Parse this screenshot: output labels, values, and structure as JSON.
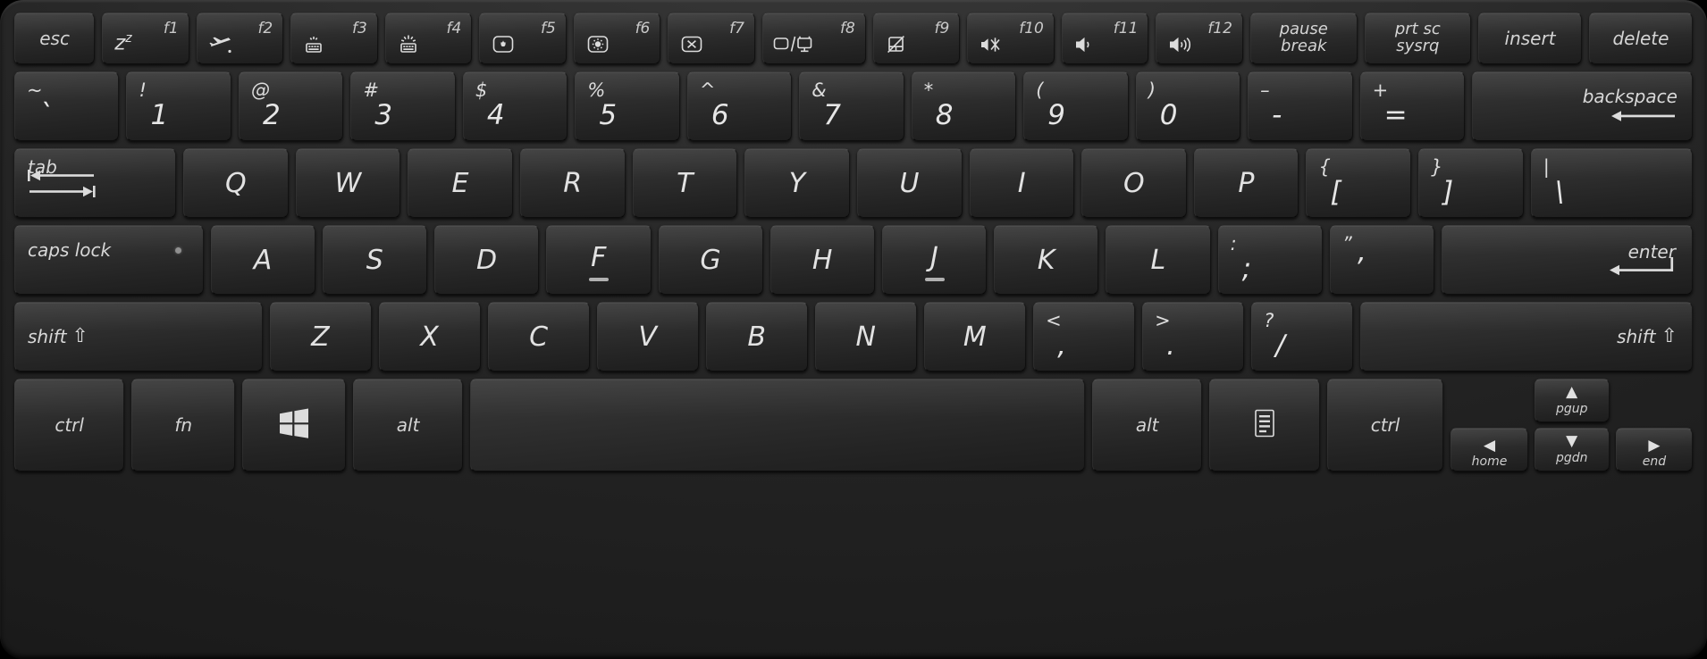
{
  "device": {
    "name": "ASUS laptop chiclet keyboard",
    "layout": "US ANSI",
    "body_color": "#262626",
    "key_color": "#2e2e2e",
    "legend_color": "#e2e2e2"
  },
  "rows": {
    "function_row": [
      {
        "id": "esc",
        "label": "esc",
        "type": "word",
        "fn": "",
        "icon": ""
      },
      {
        "id": "f1",
        "label": "",
        "type": "fn",
        "fn": "f1",
        "icon": "sleep-zz"
      },
      {
        "id": "f2",
        "label": "",
        "type": "fn",
        "fn": "f2",
        "icon": "airplane-mode"
      },
      {
        "id": "f3",
        "label": "",
        "type": "fn",
        "fn": "f3",
        "icon": "keyboard-backlight-down"
      },
      {
        "id": "f4",
        "label": "",
        "type": "fn",
        "fn": "f4",
        "icon": "keyboard-backlight-up"
      },
      {
        "id": "f5",
        "label": "",
        "type": "fn",
        "fn": "f5",
        "icon": "brightness-down"
      },
      {
        "id": "f6",
        "label": "",
        "type": "fn",
        "fn": "f6",
        "icon": "brightness-up"
      },
      {
        "id": "f7",
        "label": "",
        "type": "fn",
        "fn": "f7",
        "icon": "display-off"
      },
      {
        "id": "f8",
        "label": "",
        "type": "fn",
        "fn": "f8",
        "icon": "switch-display"
      },
      {
        "id": "f9",
        "label": "",
        "type": "fn",
        "fn": "f9",
        "icon": "touchpad-toggle"
      },
      {
        "id": "f10",
        "label": "",
        "type": "fn",
        "fn": "f10",
        "icon": "volume-mute"
      },
      {
        "id": "f11",
        "label": "",
        "type": "fn",
        "fn": "f11",
        "icon": "volume-down"
      },
      {
        "id": "f12",
        "label": "",
        "type": "fn",
        "fn": "f12",
        "icon": "volume-up"
      },
      {
        "id": "pause",
        "label": "pause\nbreak",
        "type": "word2",
        "line1": "pause",
        "line2": "break"
      },
      {
        "id": "prtsc",
        "label": "prt sc\nsysrq",
        "type": "word2",
        "line1": "prt sc",
        "line2": "sysrq"
      },
      {
        "id": "insert",
        "label": "insert",
        "type": "word"
      },
      {
        "id": "delete",
        "label": "delete",
        "type": "word"
      }
    ],
    "number_row": [
      {
        "id": "backtick",
        "shift": "~",
        "base": "`"
      },
      {
        "id": "1",
        "shift": "!",
        "base": "1"
      },
      {
        "id": "2",
        "shift": "@",
        "base": "2"
      },
      {
        "id": "3",
        "shift": "#",
        "base": "3"
      },
      {
        "id": "4",
        "shift": "$",
        "base": "4"
      },
      {
        "id": "5",
        "shift": "%",
        "base": "5"
      },
      {
        "id": "6",
        "shift": "^",
        "base": "6"
      },
      {
        "id": "7",
        "shift": "&",
        "base": "7"
      },
      {
        "id": "8",
        "shift": "*",
        "base": "8"
      },
      {
        "id": "9",
        "shift": "(",
        "base": "9"
      },
      {
        "id": "0",
        "shift": ")",
        "base": "0"
      },
      {
        "id": "minus",
        "shift": "–",
        "base": "-"
      },
      {
        "id": "equals",
        "shift": "+",
        "base": "="
      },
      {
        "id": "backspace",
        "label": "backspace",
        "icon": "arrow-left-long"
      }
    ],
    "qwerty_row": [
      {
        "id": "tab",
        "label": "tab",
        "icon": "tab-arrows"
      },
      {
        "id": "q",
        "base": "Q"
      },
      {
        "id": "w",
        "base": "W"
      },
      {
        "id": "e",
        "base": "E"
      },
      {
        "id": "r",
        "base": "R"
      },
      {
        "id": "t",
        "base": "T"
      },
      {
        "id": "y",
        "base": "Y"
      },
      {
        "id": "u",
        "base": "U"
      },
      {
        "id": "i",
        "base": "I"
      },
      {
        "id": "o",
        "base": "O"
      },
      {
        "id": "p",
        "base": "P"
      },
      {
        "id": "lbracket",
        "shift": "{",
        "base": "["
      },
      {
        "id": "rbracket",
        "shift": "}",
        "base": "]"
      },
      {
        "id": "backslash",
        "shift": "|",
        "base": "\\"
      }
    ],
    "home_row": [
      {
        "id": "capslock",
        "label": "caps lock",
        "led": true
      },
      {
        "id": "a",
        "base": "A"
      },
      {
        "id": "s",
        "base": "S"
      },
      {
        "id": "d",
        "base": "D"
      },
      {
        "id": "f",
        "base": "F",
        "homing": true
      },
      {
        "id": "g",
        "base": "G"
      },
      {
        "id": "h",
        "base": "H"
      },
      {
        "id": "j",
        "base": "J",
        "homing": true
      },
      {
        "id": "k",
        "base": "K"
      },
      {
        "id": "l",
        "base": "L"
      },
      {
        "id": "semicolon",
        "shift": ":",
        "base": ";"
      },
      {
        "id": "quote",
        "shift": "”",
        "base": "’"
      },
      {
        "id": "enter",
        "label": "enter",
        "icon": "enter-arrow"
      }
    ],
    "shift_row": [
      {
        "id": "lshift",
        "label": "shift",
        "icon": "shift-up-arrow"
      },
      {
        "id": "z",
        "base": "Z"
      },
      {
        "id": "x",
        "base": "X"
      },
      {
        "id": "c",
        "base": "C"
      },
      {
        "id": "v",
        "base": "V"
      },
      {
        "id": "b",
        "base": "B"
      },
      {
        "id": "n",
        "base": "N"
      },
      {
        "id": "m",
        "base": "M"
      },
      {
        "id": "comma",
        "shift": "<",
        "base": ","
      },
      {
        "id": "period",
        "shift": ">",
        "base": "."
      },
      {
        "id": "slash",
        "shift": "?",
        "base": "/"
      },
      {
        "id": "rshift",
        "label": "shift",
        "icon": "shift-up-arrow"
      }
    ],
    "bottom_row": [
      {
        "id": "lctrl",
        "label": "ctrl"
      },
      {
        "id": "fn",
        "label": "fn"
      },
      {
        "id": "win",
        "label": "",
        "icon": "windows-logo"
      },
      {
        "id": "lalt",
        "label": "alt"
      },
      {
        "id": "space",
        "label": ""
      },
      {
        "id": "ralt",
        "label": "alt"
      },
      {
        "id": "menu",
        "label": "",
        "icon": "context-menu"
      },
      {
        "id": "rctrl",
        "label": "ctrl"
      },
      {
        "id": "left",
        "label": "home",
        "icon": "arrow-left"
      },
      {
        "id": "up",
        "label": "pgup",
        "icon": "arrow-up"
      },
      {
        "id": "down",
        "label": "pgdn",
        "icon": "arrow-down"
      },
      {
        "id": "right",
        "label": "end",
        "icon": "arrow-right"
      }
    ]
  }
}
